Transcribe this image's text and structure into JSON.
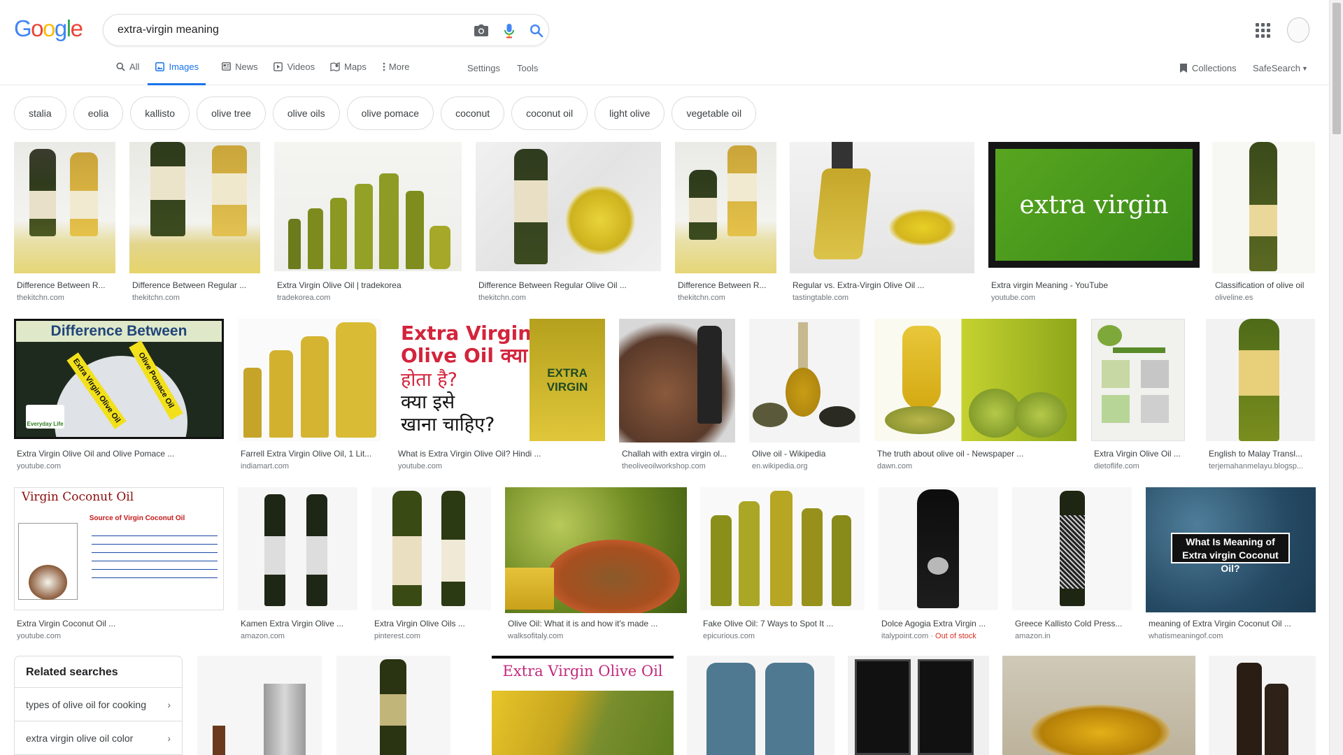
{
  "header": {
    "logo_letters": [
      "G",
      "o",
      "o",
      "g",
      "l",
      "e"
    ],
    "logo_colors": [
      "#4285F4",
      "#EA4335",
      "#FBBC05",
      "#4285F4",
      "#34A853",
      "#EA4335"
    ],
    "query": "extra-virgin meaning"
  },
  "tabs": [
    {
      "label": "All",
      "icon": "search-icon"
    },
    {
      "label": "Images",
      "icon": "image-icon",
      "active": true
    },
    {
      "label": "News",
      "icon": "news-icon"
    },
    {
      "label": "Videos",
      "icon": "video-icon"
    },
    {
      "label": "Maps",
      "icon": "map-icon"
    },
    {
      "label": "More",
      "icon": "more-icon"
    }
  ],
  "tools": {
    "settings": "Settings",
    "tools": "Tools",
    "collections": "Collections",
    "safesearch": "SafeSearch"
  },
  "chips": [
    "stalia",
    "eolia",
    "kallisto",
    "olive tree",
    "olive oils",
    "olive pomace",
    "coconut",
    "coconut oil",
    "light olive",
    "vegetable oil"
  ],
  "results": [
    {
      "title": "Difference Between R...",
      "source": "thekitchn.com"
    },
    {
      "title": "Difference Between Regular ...",
      "source": "thekitchn.com"
    },
    {
      "title": "Extra Virgin Olive Oil | tradekorea",
      "source": "tradekorea.com"
    },
    {
      "title": "Difference Between Regular Olive Oil ...",
      "source": "thekitchn.com"
    },
    {
      "title": "Difference Between R...",
      "source": "thekitchn.com"
    },
    {
      "title": "Regular vs. Extra-Virgin Olive Oil ...",
      "source": "tastingtable.com"
    },
    {
      "title": "Extra virgin Meaning - YouTube",
      "source": "youtube.com"
    },
    {
      "title": "Classification of olive oil",
      "source": "oliveline.es"
    },
    {
      "title": "Extra Virgin Olive Oil and Olive Pomace ...",
      "source": "youtube.com"
    },
    {
      "title": "Farrell Extra Virgin Olive Oil, 1 Lit...",
      "source": "indiamart.com"
    },
    {
      "title": "What is Extra Virgin Olive Oil? Hindi ...",
      "source": "youtube.com"
    },
    {
      "title": "Challah with extra virgin ol...",
      "source": "theoliveoilworkshop.com"
    },
    {
      "title": "Olive oil - Wikipedia",
      "source": "en.wikipedia.org"
    },
    {
      "title": "The truth about olive oil - Newspaper ...",
      "source": "dawn.com"
    },
    {
      "title": "Extra Virgin Olive Oil ...",
      "source": "dietoflife.com"
    },
    {
      "title": "English to Malay Transl...",
      "source": "terjemahanmelayu.blogsp..."
    },
    {
      "title": "Extra Virgin Coconut Oil ...",
      "source": "youtube.com"
    },
    {
      "title": "Kamen Extra Virgin Olive ...",
      "source": "amazon.com"
    },
    {
      "title": "Extra Virgin Olive Oils ...",
      "source": "pinterest.com"
    },
    {
      "title": "Olive Oil: What it is and how it's made ...",
      "source": "walksofitaly.com"
    },
    {
      "title": "Fake Olive Oil: 7 Ways to Spot It ...",
      "source": "epicurious.com"
    },
    {
      "title": "Dolce Agogia Extra Virgin ...",
      "source": "italypoint.com",
      "badge": "Out of stock"
    },
    {
      "title": "Greece Kallisto Cold Press...",
      "source": "amazon.in"
    },
    {
      "title": "meaning of Extra Virgin Coconut Oil ...",
      "source": "whatismeaningof.com"
    }
  ],
  "image_text": {
    "extra_virgin": "extra virgin",
    "difference_between": "Difference Between",
    "extra_virgin_olive_oil": "Extra Virgin Olive Oil",
    "olive_pomace_oil": "Olive Pomace Oil",
    "everyday_life": "Everyday Life",
    "hindi_line1": "Extra Virgin",
    "hindi_line2": "Olive Oil क्या",
    "hindi_line3": "होता है?",
    "hindi_line4": "क्या इसे",
    "hindi_line5": "खाना चाहिए?",
    "extra_virgin_label": "EXTRA VIRGIN",
    "virgin_coconut_oil": "Virgin Coconut Oil",
    "source_virgin_coconut": "Source of Virgin Coconut Oil",
    "what_is_meaning": "What Is Meaning of Extra virgin Coconut Oil?",
    "evoo_banner": "Extra Virgin Olive Oil"
  },
  "related": {
    "title": "Related searches",
    "items": [
      "types of olive oil for cooking",
      "extra virgin olive oil color"
    ]
  }
}
